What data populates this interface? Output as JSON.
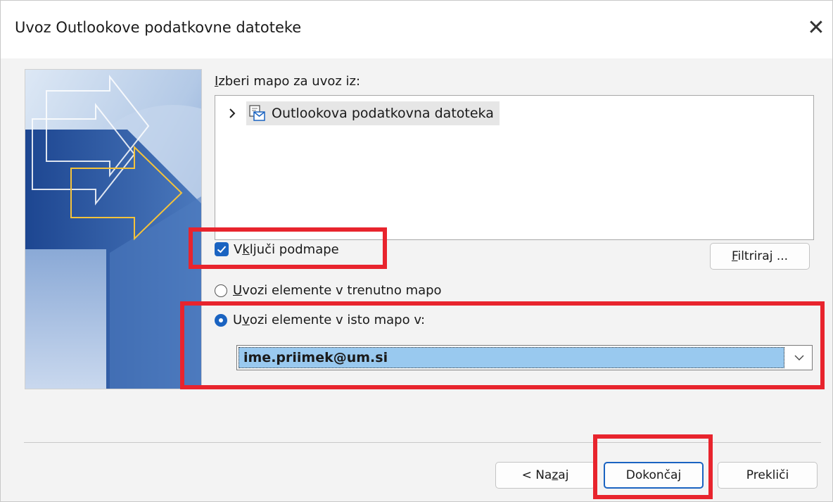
{
  "window": {
    "title": "Uvoz Outlookove podatkovne datoteke",
    "close_glyph": "✕"
  },
  "folder_section": {
    "label_first": "I",
    "label_rest": "zberi mapo za uvoz iz:",
    "tree_item": "Outlookova podatkovna datoteka",
    "tree_icon": "pst-file-icon",
    "tree_expander": "›"
  },
  "include_subfolders": {
    "pre": "V",
    "accel": "k",
    "post": "ljuči podmape",
    "checked": true
  },
  "filter_button": {
    "accel": "F",
    "rest": "iltriraj ..."
  },
  "import_options": {
    "current": {
      "accel": "U",
      "rest": "vozi elemente v trenutno mapo",
      "selected": false
    },
    "same": {
      "pre": "U",
      "accel": "v",
      "post": "ozi elemente v isto mapo v:",
      "selected": true
    }
  },
  "target_mailbox": {
    "value": "ime.priimek@um.si"
  },
  "buttons": {
    "back": {
      "pre": "< Na",
      "accel": "z",
      "post": "aj"
    },
    "finish": "Dokončaj",
    "cancel": "Prekliči"
  },
  "colors": {
    "accent": "#1a63c1",
    "highlight": "#e8242d",
    "selection": "#99c9ef"
  }
}
